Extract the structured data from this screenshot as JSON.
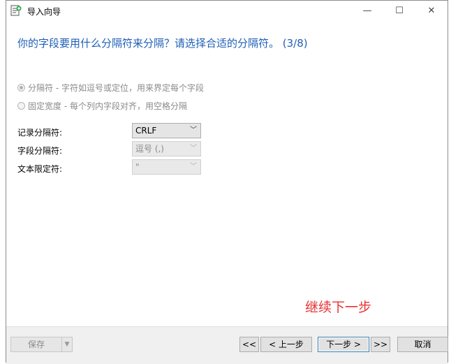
{
  "window": {
    "title": "导入向导",
    "minimize": "—",
    "maximize": "☐",
    "close": "✕"
  },
  "heading": "你的字段要用什么分隔符来分隔？请选择合适的分隔符。 (3/8)",
  "options": [
    {
      "label": "分隔符 - 字符如逗号或定位，用来界定每个字段",
      "checked": true
    },
    {
      "label": "固定宽度 - 每个列内字段对齐，用空格分隔",
      "checked": false
    }
  ],
  "fields": {
    "record_label": "记录分隔符:",
    "record_value": "CRLF",
    "field_label": "字段分隔符:",
    "field_value": "逗号 (,)",
    "text_label": "文本限定符:",
    "text_value": "\""
  },
  "annotation": "继续下一步",
  "footer": {
    "save": "保存",
    "first": "<<",
    "prev": "< 上一步",
    "next": "下一步 >",
    "last": ">>",
    "cancel": "取消"
  },
  "colors": {
    "heading": "#1f5fb5",
    "annotation": "#e83232"
  }
}
